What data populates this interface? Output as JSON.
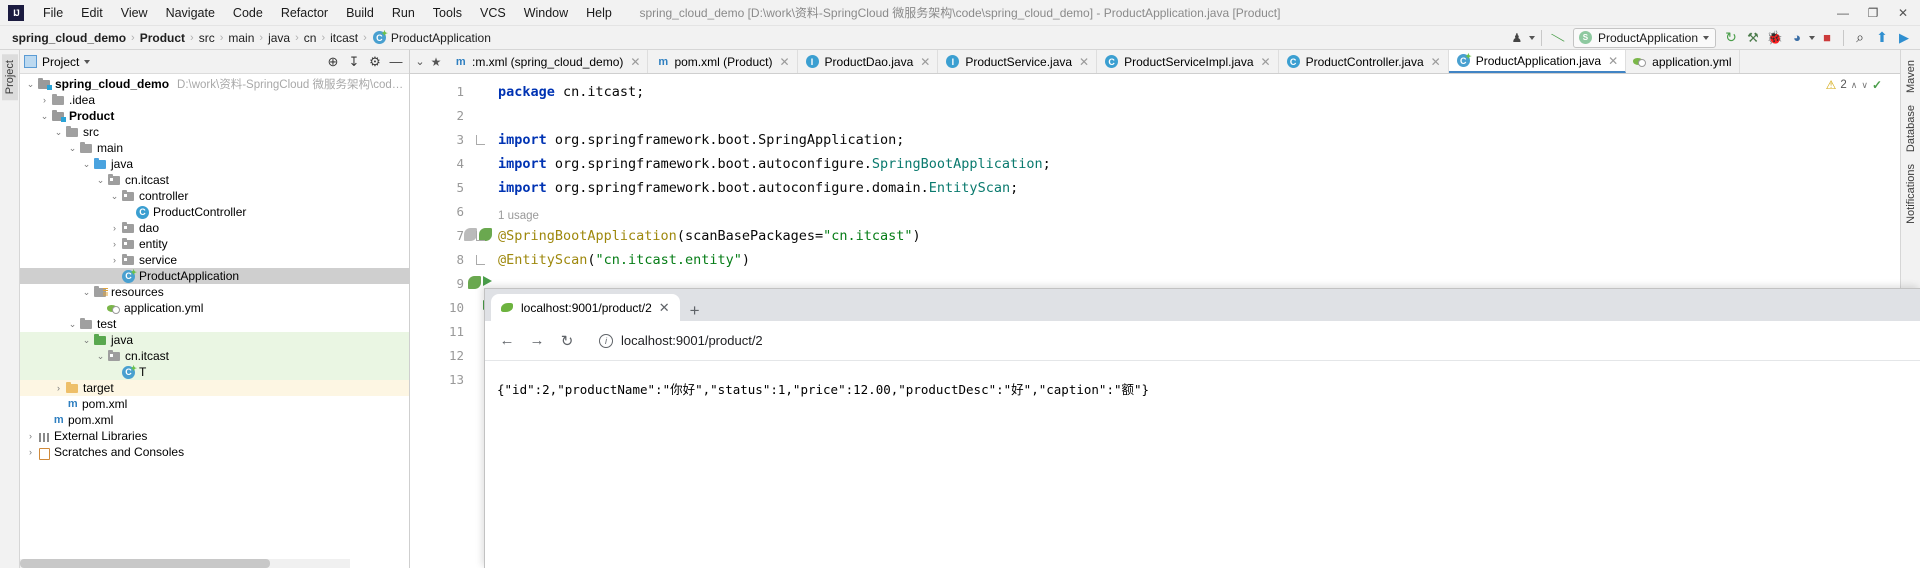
{
  "window": {
    "title": "spring_cloud_demo [D:\\work\\资料-SpringCloud 微服务架构\\code\\spring_cloud_demo] - ProductApplication.java [Product]",
    "logo": "IJ",
    "minimize": "—",
    "maximize": "☐",
    "restore": "❐",
    "close": "✕"
  },
  "menu": {
    "items": [
      {
        "label": "File"
      },
      {
        "label": "Edit"
      },
      {
        "label": "View"
      },
      {
        "label": "Navigate"
      },
      {
        "label": "Code"
      },
      {
        "label": "Refactor"
      },
      {
        "label": "Build"
      },
      {
        "label": "Run"
      },
      {
        "label": "Tools"
      },
      {
        "label": "VCS"
      },
      {
        "label": "Window"
      },
      {
        "label": "Help"
      }
    ]
  },
  "breadcrumbs": {
    "items": [
      {
        "label": "spring_cloud_demo",
        "bold": true
      },
      {
        "label": "Product",
        "bold": true
      },
      {
        "label": "src",
        "bold": false
      },
      {
        "label": "main",
        "bold": false
      },
      {
        "label": "java",
        "bold": false
      },
      {
        "label": "cn",
        "bold": false
      },
      {
        "label": "itcast",
        "bold": false
      },
      {
        "label": "ProductApplication",
        "bold": false,
        "icon": "java-class-icon"
      }
    ],
    "separator": "›"
  },
  "toolbar": {
    "run_configuration": "ProductApplication",
    "icons": [
      {
        "name": "user-profile-icon",
        "glyph": "♟"
      },
      {
        "name": "build-hammer-icon",
        "glyph": "⚒"
      },
      {
        "name": "rerun-icon",
        "glyph": "↻"
      },
      {
        "name": "run-with-coverage-icon",
        "glyph": "⚗"
      },
      {
        "name": "debug-icon",
        "glyph": "ὁE"
      },
      {
        "name": "profiler-icon",
        "glyph": "◔"
      },
      {
        "name": "stop-icon",
        "glyph": "■"
      },
      {
        "name": "search-everywhere-icon",
        "glyph": "⌕"
      },
      {
        "name": "update-project-icon",
        "glyph": "⬆"
      },
      {
        "name": "run-icon",
        "glyph": "▶"
      }
    ]
  },
  "left_stripe": {
    "tabs": [
      {
        "label": "Project",
        "active": true
      }
    ]
  },
  "right_stripe": {
    "tabs": [
      {
        "label": "Maven"
      },
      {
        "label": "Database"
      },
      {
        "label": "Notifications"
      }
    ]
  },
  "project_panel": {
    "title": "Project",
    "head_icons": [
      {
        "name": "select-opened-file-icon",
        "glyph": "⊕"
      },
      {
        "name": "collapse-all-icon",
        "glyph": "↧"
      },
      {
        "name": "settings-gear-icon",
        "glyph": "⚙"
      },
      {
        "name": "hide-panel-icon",
        "glyph": "—"
      }
    ],
    "tree": [
      {
        "label": "spring_cloud_demo",
        "path": "D:\\work\\资料-SpringCloud 微服务架构\\code\\spring_clo",
        "indent": 0,
        "twist": "⌄",
        "icon": "module-icon",
        "bold": true,
        "state": "normal"
      },
      {
        "label": ".idea",
        "indent": 1,
        "twist": "›",
        "icon": "folder-icon",
        "bold": false,
        "state": "normal"
      },
      {
        "label": "Product",
        "indent": 1,
        "twist": "⌄",
        "icon": "module-icon",
        "bold": true,
        "state": "normal"
      },
      {
        "label": "src",
        "indent": 2,
        "twist": "⌄",
        "icon": "folder-icon",
        "bold": false,
        "state": "normal"
      },
      {
        "label": "main",
        "indent": 3,
        "twist": "⌄",
        "icon": "folder-icon",
        "bold": false,
        "state": "normal"
      },
      {
        "label": "java",
        "indent": 4,
        "twist": "⌄",
        "icon": "source-folder-icon",
        "bold": false,
        "state": "normal"
      },
      {
        "label": "cn.itcast",
        "indent": 5,
        "twist": "⌄",
        "icon": "package-icon",
        "bold": false,
        "state": "normal"
      },
      {
        "label": "controller",
        "indent": 6,
        "twist": "⌄",
        "icon": "package-icon",
        "bold": false,
        "state": "normal"
      },
      {
        "label": "ProductController",
        "indent": 7,
        "twist": "",
        "icon": "java-class-icon",
        "bold": false,
        "state": "normal"
      },
      {
        "label": "dao",
        "indent": 6,
        "twist": "›",
        "icon": "package-icon",
        "bold": false,
        "state": "normal"
      },
      {
        "label": "entity",
        "indent": 6,
        "twist": "›",
        "icon": "package-icon",
        "bold": false,
        "state": "normal"
      },
      {
        "label": "service",
        "indent": 6,
        "twist": "›",
        "icon": "package-icon",
        "bold": false,
        "state": "normal"
      },
      {
        "label": "ProductApplication",
        "indent": 6,
        "twist": "",
        "icon": "java-runnable-class-icon",
        "bold": false,
        "state": "selected"
      },
      {
        "label": "resources",
        "indent": 4,
        "twist": "⌄",
        "icon": "resources-folder-icon",
        "bold": false,
        "state": "normal"
      },
      {
        "label": "application.yml",
        "indent": 5,
        "twist": "",
        "icon": "spring-yaml-icon",
        "bold": false,
        "state": "normal"
      },
      {
        "label": "test",
        "indent": 3,
        "twist": "⌄",
        "icon": "folder-icon",
        "bold": false,
        "state": "normal"
      },
      {
        "label": "java",
        "indent": 4,
        "twist": "⌄",
        "icon": "test-source-folder-icon",
        "bold": false,
        "state": "green"
      },
      {
        "label": "cn.itcast",
        "indent": 5,
        "twist": "⌄",
        "icon": "package-icon",
        "bold": false,
        "state": "green"
      },
      {
        "label": "T",
        "indent": 6,
        "twist": "",
        "icon": "java-runnable-class-icon",
        "bold": false,
        "state": "green"
      },
      {
        "label": "target",
        "indent": 2,
        "twist": "›",
        "icon": "excluded-folder-icon",
        "bold": false,
        "state": "yellow"
      },
      {
        "label": "pom.xml",
        "indent": 2,
        "twist": "",
        "icon": "maven-icon",
        "bold": false,
        "state": "normal"
      },
      {
        "label": "pom.xml",
        "indent": 1,
        "twist": "",
        "icon": "maven-icon",
        "bold": false,
        "state": "normal"
      },
      {
        "label": "External Libraries",
        "indent": 0,
        "twist": "›",
        "icon": "libraries-icon",
        "bold": false,
        "state": "normal"
      },
      {
        "label": "Scratches and Consoles",
        "indent": 0,
        "twist": "›",
        "icon": "scratches-icon",
        "bold": false,
        "state": "normal"
      }
    ]
  },
  "editor_tabs": {
    "left_icons": [
      {
        "name": "tab-list-icon",
        "glyph": "⌄"
      },
      {
        "name": "bookmark-star-icon",
        "glyph": "★"
      }
    ],
    "tabs": [
      {
        "label": ":m.xml (spring_cloud_demo)",
        "icon": "maven-icon",
        "active": false,
        "closable": true
      },
      {
        "label": "pom.xml (Product)",
        "icon": "maven-icon",
        "active": false,
        "closable": true
      },
      {
        "label": "ProductDao.java",
        "icon": "java-interface-icon",
        "active": false,
        "closable": true
      },
      {
        "label": "ProductService.java",
        "icon": "java-interface-icon",
        "active": false,
        "closable": true
      },
      {
        "label": "ProductServiceImpl.java",
        "icon": "java-class-icon",
        "active": false,
        "closable": true
      },
      {
        "label": "ProductController.java",
        "icon": "java-class-icon",
        "active": false,
        "closable": true
      },
      {
        "label": "ProductApplication.java",
        "icon": "java-runnable-class-icon",
        "active": true,
        "closable": true
      },
      {
        "label": "application.yml",
        "icon": "spring-yaml-icon",
        "active": false,
        "closable": false
      }
    ]
  },
  "code": {
    "inspection": {
      "warnings": "2",
      "up": "∧",
      "down": "∨",
      "check": "✓"
    },
    "usage_hint": "1 usage",
    "lines": [
      {
        "n": "1",
        "tokens": [
          {
            "t": "package",
            "c": "kw"
          },
          {
            "t": " cn.itcast;",
            "c": "pln"
          }
        ]
      },
      {
        "n": "2",
        "tokens": []
      },
      {
        "n": "3",
        "tokens": [
          {
            "t": "import",
            "c": "kw"
          },
          {
            "t": " org.springframework.boot.SpringApplication;",
            "c": "pln"
          }
        ]
      },
      {
        "n": "4",
        "tokens": [
          {
            "t": "import",
            "c": "kw"
          },
          {
            "t": " org.springframework.boot.autoconfigure.",
            "c": "pln"
          },
          {
            "t": "SpringBootApplication",
            "c": "typ"
          },
          {
            "t": ";",
            "c": "pln"
          }
        ]
      },
      {
        "n": "5",
        "tokens": [
          {
            "t": "import",
            "c": "kw"
          },
          {
            "t": " org.springframework.boot.autoconfigure.domain.",
            "c": "pln"
          },
          {
            "t": "EntityScan",
            "c": "typ"
          },
          {
            "t": ";",
            "c": "pln"
          }
        ]
      },
      {
        "n": "6",
        "tokens": []
      },
      {
        "n": "7",
        "tokens": [
          {
            "t": "@SpringBootApplication",
            "c": "ann"
          },
          {
            "t": "(scanBasePackages=",
            "c": "pln"
          },
          {
            "t": "\"cn.itcast\"",
            "c": "str"
          },
          {
            "t": ")",
            "c": "pln"
          }
        ]
      },
      {
        "n": "8",
        "tokens": [
          {
            "t": "@EntityScan",
            "c": "ann"
          },
          {
            "t": "(",
            "c": "pln"
          },
          {
            "t": "\"cn.itcast.entity\"",
            "c": "str"
          },
          {
            "t": ")",
            "c": "pln"
          }
        ]
      },
      {
        "n": "9",
        "tokens": []
      },
      {
        "n": "10",
        "tokens": []
      },
      {
        "n": "11",
        "tokens": []
      },
      {
        "n": "12",
        "tokens": []
      },
      {
        "n": "13",
        "tokens": []
      }
    ]
  },
  "browser": {
    "tab": {
      "title": "localhost:9001/product/2",
      "close": "✕"
    },
    "new_tab": "+",
    "nav": {
      "back": "←",
      "forward": "→",
      "reload": "↻",
      "info": "i"
    },
    "url": "localhost:9001/product/2",
    "response_body": "{\"id\":2,\"productName\":\"你好\",\"status\":1,\"price\":12.00,\"productDesc\":\"好\",\"caption\":\"额\"}"
  },
  "colors": {
    "accent": "#4184c4",
    "keyword": "#0033b3",
    "string": "#067d17",
    "annotation": "#9e880d",
    "type": "#0a7a6e",
    "selection": "#cfcfcf",
    "test_source": "#eaf6e3",
    "excluded": "#fdf6e3"
  }
}
